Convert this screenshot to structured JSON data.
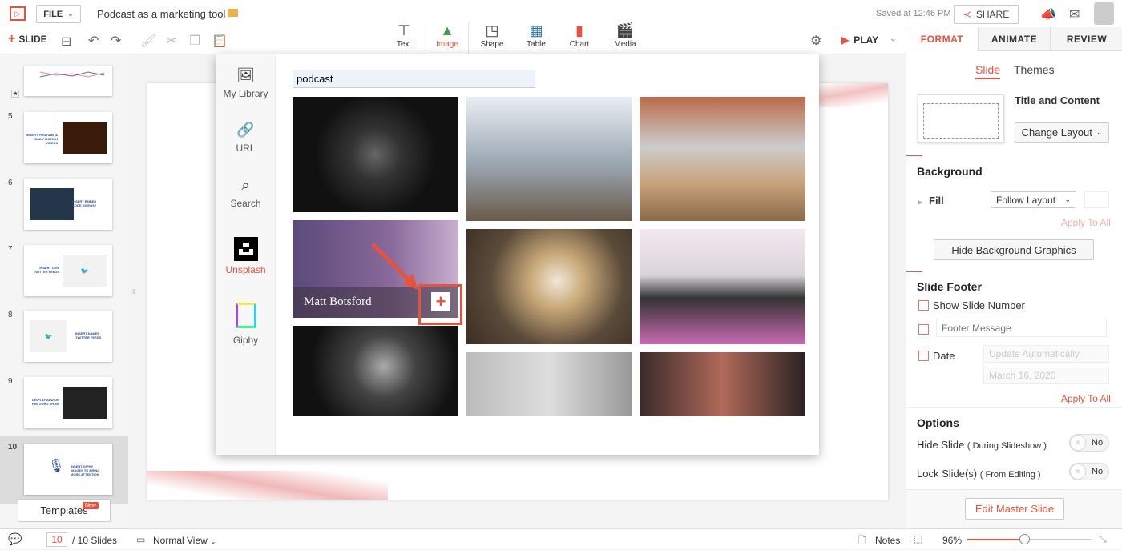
{
  "app": {
    "file_label": "FILE",
    "doc_title": "Podcast as a marketing tool",
    "saved_status": "Saved at 12:46 PM",
    "share_label": "SHARE"
  },
  "toolbar": {
    "slide_label": "SLIDE",
    "play_label": "PLAY",
    "insert_tools": [
      {
        "label": "Text",
        "icon": "text-box-icon"
      },
      {
        "label": "Image",
        "icon": "image-icon",
        "active": true
      },
      {
        "label": "Shape",
        "icon": "shape-icon"
      },
      {
        "label": "Table",
        "icon": "table-icon"
      },
      {
        "label": "Chart",
        "icon": "bar-chart-icon"
      },
      {
        "label": "Media",
        "icon": "clapperboard-icon"
      }
    ]
  },
  "right_tabs": [
    {
      "label": "FORMAT",
      "active": true
    },
    {
      "label": "ANIMATE"
    },
    {
      "label": "REVIEW"
    }
  ],
  "format": {
    "subtabs": [
      "Slide",
      "Themes"
    ],
    "layout_name": "Title and Content",
    "change_layout": "Change Layout",
    "background_title": "Background",
    "fill_label": "Fill",
    "fill_value": "Follow Layout",
    "apply_all": "Apply To All",
    "hide_bg": "Hide Background Graphics",
    "footer_title": "Slide Footer",
    "show_slide_number": "Show Slide Number",
    "footer_placeholder": "Footer Message",
    "date_label": "Date",
    "date_mode": "Update Automatically",
    "date_value": "March 16, 2020",
    "apply_all_2": "Apply To All",
    "options_title": "Options",
    "hide_slide": "Hide Slide",
    "hide_slide_note": "( During Slideshow )",
    "lock_slide": "Lock Slide(s)",
    "lock_slide_note": "( From Editing )",
    "toggle_off": "No",
    "edit_master": "Edit Master Slide"
  },
  "slides": [
    {
      "num": "5",
      "text": "INSERT YOUTUBE & DAILY MOTION VIDEOS"
    },
    {
      "num": "6",
      "text": "INSERT EMBED CODE VIDEOS?"
    },
    {
      "num": "7",
      "text": "INSERT LIVE TWITTER FEEDS"
    },
    {
      "num": "8",
      "text": "INSERT NAMED TWITTER FEEDS"
    },
    {
      "num": "9",
      "text": "DISPLAY ADD-ON FEE ZOHO SHOW"
    },
    {
      "num": "10",
      "text": "INSERT GIPHY IMAGES TO BRING MORE ATTENTION",
      "active": true
    }
  ],
  "templates": {
    "label": "Templates",
    "badge": "New"
  },
  "image_dialog": {
    "sources": [
      {
        "label": "My Library",
        "icon": "library-icon"
      },
      {
        "label": "URL",
        "icon": "link-icon"
      },
      {
        "label": "Search",
        "icon": "search-icon"
      },
      {
        "label": "Unsplash",
        "icon": "unsplash-icon",
        "active": true
      },
      {
        "label": "Giphy",
        "icon": "giphy-icon"
      }
    ],
    "search_value": "podcast",
    "hover_author": "Matt Botsford"
  },
  "status": {
    "current_slide": "10",
    "total": "/ 10 Slides",
    "view": "Normal View",
    "notes": "Notes",
    "zoom": "96%",
    "zoom_percent": 96
  },
  "colors": {
    "accent": "#e5533d",
    "link_blue": "#2b4a9c"
  }
}
